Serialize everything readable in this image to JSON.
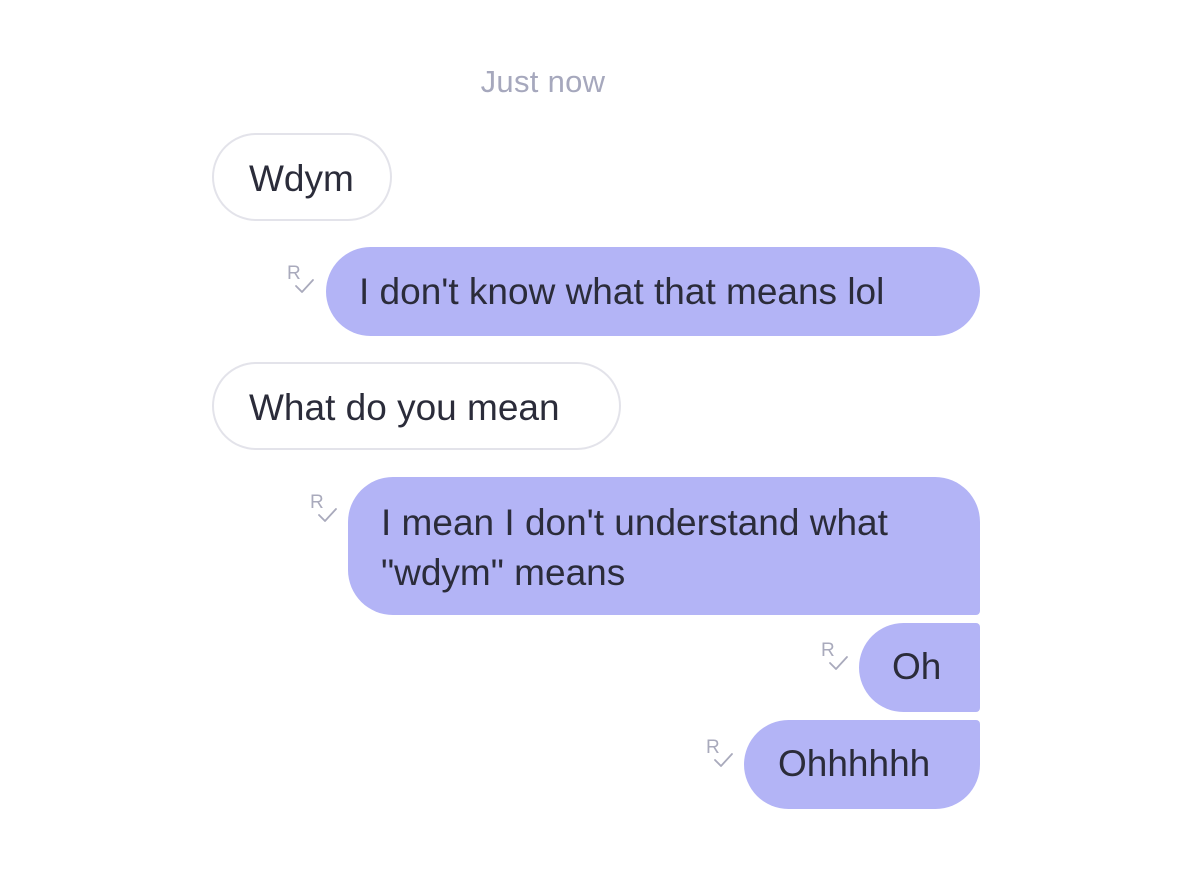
{
  "conversation": {
    "timestamp": "Just now",
    "receipt_letter": "R",
    "colors": {
      "incoming_bg": "#ffffff",
      "incoming_border": "#e3e3ea",
      "outgoing_bg": "#b3b4f6",
      "text": "#2b2c3a",
      "timestamp": "#a6a8bd",
      "receipt": "#a9aabc"
    },
    "messages": [
      {
        "direction": "incoming",
        "text": "Wdym"
      },
      {
        "direction": "outgoing",
        "text": "I don't know what that means lol",
        "receipt_icon": "read-receipt-icon"
      },
      {
        "direction": "incoming",
        "text": "What do you mean"
      },
      {
        "direction": "outgoing",
        "lines": [
          "I mean I don't understand what",
          "\"wdym\" means"
        ],
        "receipt_icon": "read-receipt-icon"
      },
      {
        "direction": "outgoing",
        "text": "Oh",
        "receipt_icon": "read-receipt-icon"
      },
      {
        "direction": "outgoing",
        "text": "Ohhhhhh",
        "receipt_icon": "read-receipt-icon"
      }
    ]
  }
}
